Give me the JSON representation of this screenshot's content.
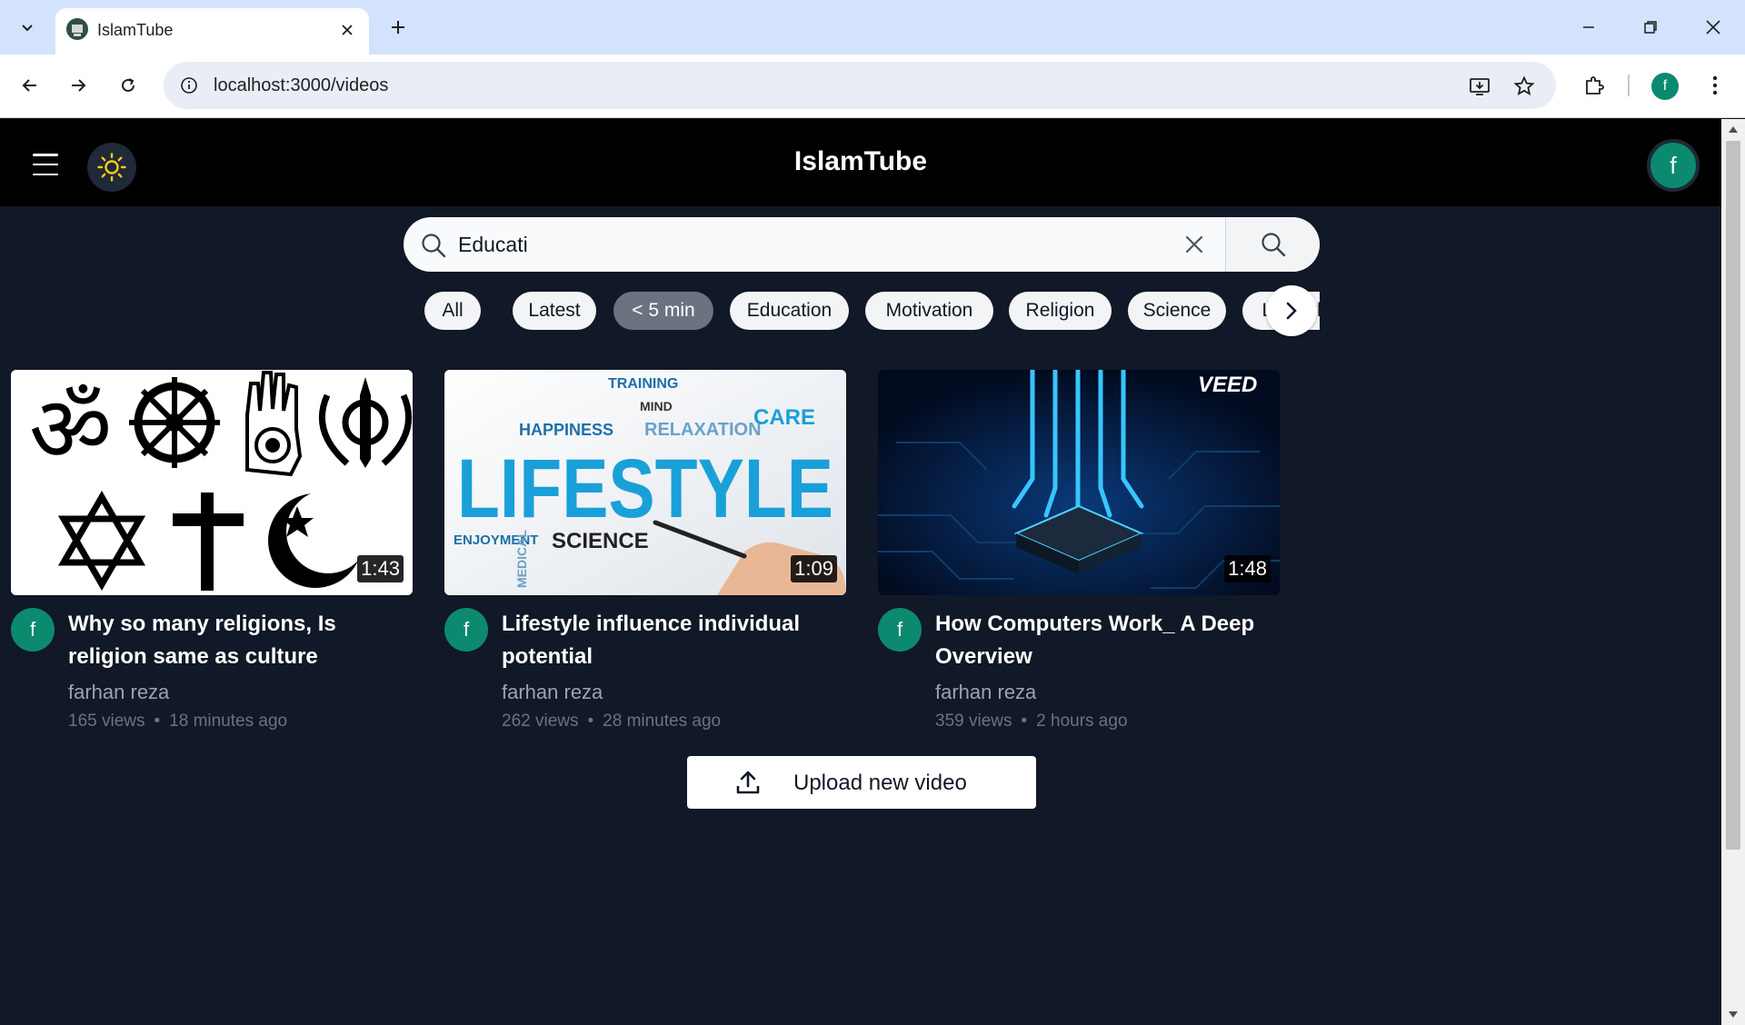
{
  "browser": {
    "tab_title": "IslamTube",
    "url": "localhost:3000/videos",
    "profile_initial": "f"
  },
  "header": {
    "title": "IslamTube",
    "avatar_initial": "f",
    "theme_icon": "sun-icon"
  },
  "search": {
    "value": "Educati",
    "placeholder": "Search"
  },
  "chips": [
    {
      "label": "All",
      "active": false
    },
    {
      "label": "Latest",
      "active": false
    },
    {
      "label": "< 5 min",
      "active": true
    },
    {
      "label": "Education",
      "active": false
    },
    {
      "label": "Motivation",
      "active": false
    },
    {
      "label": "Religion",
      "active": false
    },
    {
      "label": "Science",
      "active": false
    },
    {
      "label": "Lifestyle",
      "active": false
    }
  ],
  "videos": [
    {
      "title": "Why so many religions, Is religion same as culture",
      "channel": "farhan reza",
      "views": "165 views",
      "time": "18 minutes ago",
      "duration": "1:43",
      "avatar_initial": "f",
      "thumb_words": []
    },
    {
      "title": "Lifestyle influence individual potential",
      "channel": "farhan reza",
      "views": "262 views",
      "time": "28 minutes ago",
      "duration": "1:09",
      "avatar_initial": "f",
      "thumb_words": [
        "LIFESTYLE",
        "HAPPINESS",
        "RELAXATION",
        "TRAINING",
        "SCIENCE",
        "ENJOYMENT",
        "CARE",
        "MIND",
        "MEDICAL"
      ]
    },
    {
      "title": "How Computers Work_ A Deep Overview",
      "channel": "farhan reza",
      "views": "359 views",
      "time": "2 hours ago",
      "duration": "1:48",
      "avatar_initial": "f",
      "thumb_words": [
        "VEED"
      ]
    }
  ],
  "upload": {
    "label": "Upload new video"
  },
  "colors": {
    "page_bg": "#111827",
    "header_bg": "#000000",
    "avatar": "#0b8a6f",
    "chip_active": "#6b7280"
  }
}
